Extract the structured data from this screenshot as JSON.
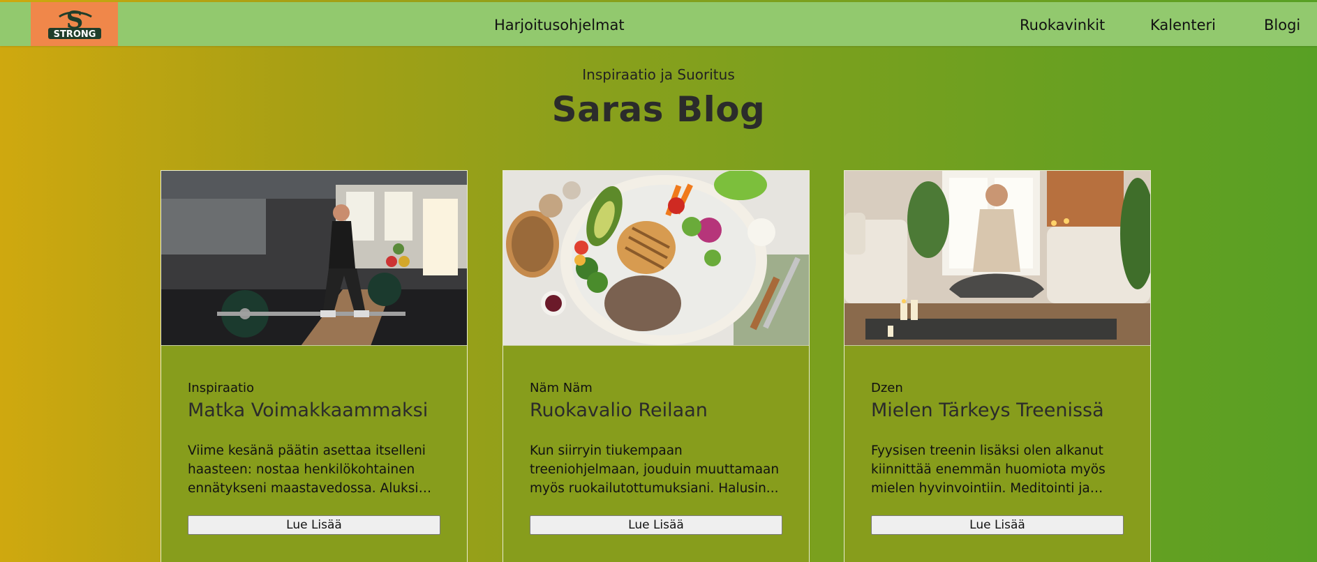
{
  "header": {
    "logo_text": "STRONG",
    "logo_letter": "S",
    "nav": [
      {
        "label": "Harjoitusohjelmat"
      },
      {
        "label": "Ruokavinkit"
      },
      {
        "label": "Kalenteri"
      },
      {
        "label": "Blogi"
      }
    ]
  },
  "hero": {
    "subtitle": "Inspiraatio ja Suoritus",
    "title": "Saras Blog"
  },
  "posts": [
    {
      "category": "Inspiraatio",
      "title": "Matka Voimakkaammaksi",
      "excerpt": "Viime kesänä päätin asettaa itselleni haasteen: nostaa henkilökohtainen ennätykseni maastavedossa. Aluksi en...",
      "button": "Lue Lisää",
      "image": "gym-deadlift-photo"
    },
    {
      "category": "Näm Näm",
      "title": "Ruokavalio Reilaan",
      "excerpt": "Kun siirryin tiukempaan treeniohjelmaan, jouduin muuttamaan myös ruokailutottumuksiani. Halusin...",
      "button": "Lue Lisää",
      "image": "healthy-meal-plate-photo"
    },
    {
      "category": "Dzen",
      "title": "Mielen Tärkeys Treenissä",
      "excerpt": "Fyysisen treenin lisäksi olen alkanut kiinnittää enemmän huomiota myös mielen hyvinvointiin. Meditointi ja kevy...",
      "button": "Lue Lisää",
      "image": "meditation-living-room-photo"
    }
  ],
  "colors": {
    "header_bg": "#92c96e",
    "logo_bg": "#f0874a",
    "card_bg": "#879d1c",
    "gradient_start": "#cfa80f",
    "gradient_end": "#58a024"
  }
}
